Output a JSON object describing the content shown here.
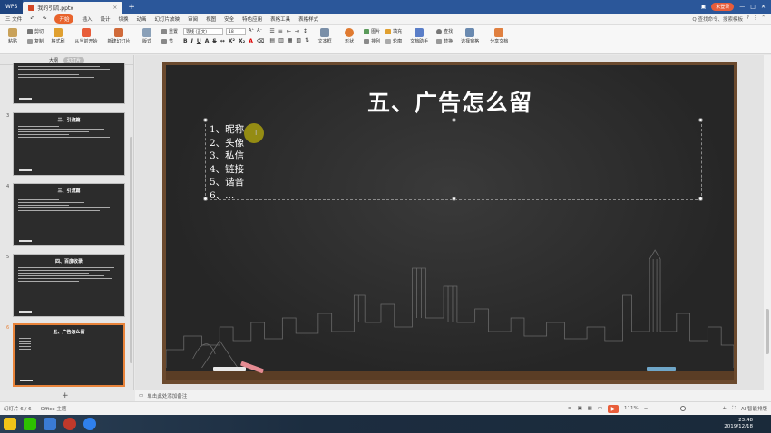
{
  "titlebar": {
    "app": "WPS",
    "doc_tab": "我的引流.pptx",
    "login": "未登录"
  },
  "menu": {
    "file": "三 文件",
    "items": [
      "开始",
      "插入",
      "设计",
      "切换",
      "动画",
      "幻灯片放映",
      "审阅",
      "视图",
      "安全",
      "特色应用",
      "表格工具",
      "表格样式"
    ],
    "search": "Q 查找命令、搜索模板"
  },
  "ribbon": {
    "paste": "粘贴",
    "cut": "剪切",
    "copy": "复制",
    "format_painter": "格式刷",
    "from_current": "从当前开始",
    "new_slide": "新建幻灯片",
    "layout": "版式",
    "reset": "重置",
    "section": "节",
    "font_name": "等线 (正文)",
    "font_size": "18",
    "textbox": "文本框",
    "shape": "形状",
    "arrange": "排列",
    "picture": "图片",
    "fill": "填充",
    "outline": "轮廓",
    "doc_assistant": "文档助手",
    "find": "查找",
    "replace": "替换",
    "select_pane": "选择窗格",
    "share": "分享文档"
  },
  "panel": {
    "tab_outline": "大纲",
    "tab_slides": "幻灯片",
    "add": "+"
  },
  "thumbs": [
    {
      "num": "",
      "title": ""
    },
    {
      "num": "3",
      "title": "三、引流篇"
    },
    {
      "num": "4",
      "title": "三、引流篇"
    },
    {
      "num": "5",
      "title": "四、百度收录"
    },
    {
      "num": "6",
      "title": "五、广告怎么留"
    }
  ],
  "slide": {
    "title": "五、广告怎么留",
    "items": [
      "1、昵称",
      "2、头像",
      "3、私信",
      "4、链接",
      "5、谐音",
      "6、..."
    ]
  },
  "notes": {
    "placeholder": "单击此处添加备注"
  },
  "status": {
    "slide_count": "幻灯片 6 / 6",
    "theme": "Office 主题",
    "zoom": "111%",
    "ai": "AI·智能排版"
  },
  "taskbar": {
    "time": "23:48",
    "date": "2019/12/18"
  }
}
